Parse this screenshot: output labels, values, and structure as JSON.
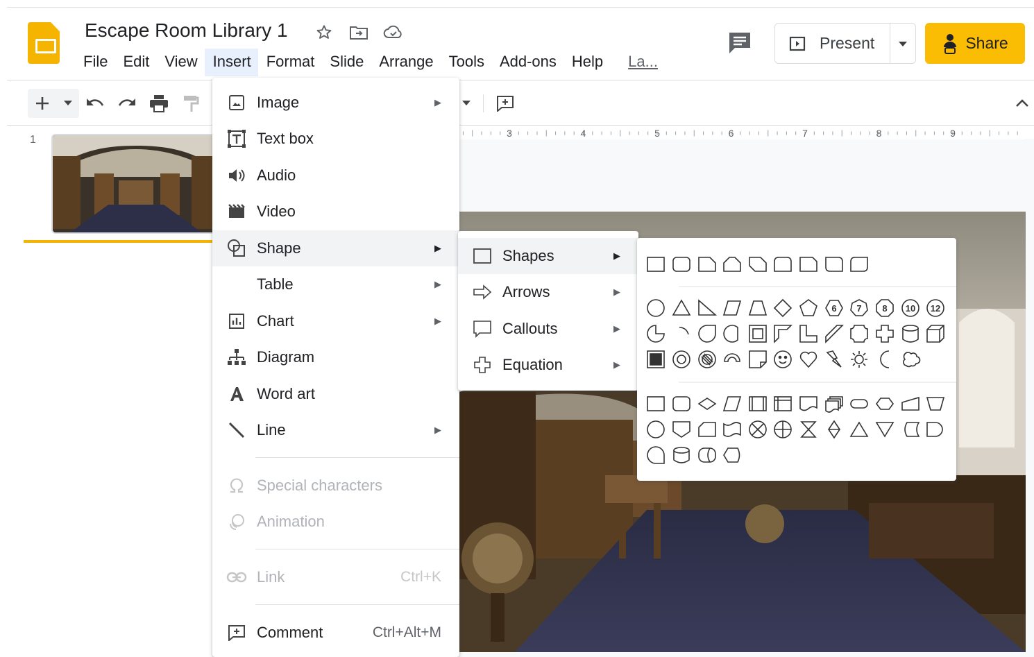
{
  "doc": {
    "title": "Escape Room Library 1"
  },
  "menubar": [
    "File",
    "Edit",
    "View",
    "Insert",
    "Format",
    "Slide",
    "Arrange",
    "Tools",
    "Add-ons",
    "Help",
    "La..."
  ],
  "header": {
    "present_label": "Present",
    "share_label": "Share"
  },
  "filmstrip": {
    "slide_number": "1"
  },
  "ruler": {
    "numbers": [
      "3",
      "4",
      "5",
      "6",
      "7",
      "8",
      "9"
    ]
  },
  "insert_menu": {
    "items": [
      {
        "label": "Image",
        "icon": "image-icon",
        "submenu": true
      },
      {
        "label": "Text box",
        "icon": "text-box-icon"
      },
      {
        "label": "Audio",
        "icon": "audio-icon"
      },
      {
        "label": "Video",
        "icon": "video-icon"
      },
      {
        "label": "Shape",
        "icon": "shape-icon",
        "submenu": true,
        "highlighted": true
      },
      {
        "label": "Table",
        "submenu": true
      },
      {
        "label": "Chart",
        "icon": "chart-icon",
        "submenu": true
      },
      {
        "label": "Diagram",
        "icon": "diagram-icon"
      },
      {
        "label": "Word art",
        "icon": "word-art-icon"
      },
      {
        "label": "Line",
        "icon": "line-icon",
        "submenu": true
      },
      {
        "label": "Special characters",
        "icon": "omega-icon",
        "disabled": true
      },
      {
        "label": "Animation",
        "icon": "animation-icon",
        "disabled": true
      },
      {
        "label": "Link",
        "icon": "link-icon",
        "shortcut": "Ctrl+K",
        "disabled": true
      },
      {
        "label": "Comment",
        "icon": "comment-icon",
        "shortcut": "Ctrl+Alt+M"
      }
    ]
  },
  "shape_menu": {
    "items": [
      {
        "label": "Shapes",
        "icon": "rectangle-icon",
        "highlighted": true
      },
      {
        "label": "Arrows",
        "icon": "arrow-icon"
      },
      {
        "label": "Callouts",
        "icon": "callout-icon"
      },
      {
        "label": "Equation",
        "icon": "plus-icon"
      }
    ]
  },
  "shapes_grid": {
    "octagon_numbers": [
      "6",
      "7",
      "8",
      "10",
      "12"
    ]
  },
  "colors": {
    "accent_yellow": "#fbbc04",
    "menu_active_bg": "#e8f0fe",
    "hover_bg": "#f1f3f4"
  }
}
